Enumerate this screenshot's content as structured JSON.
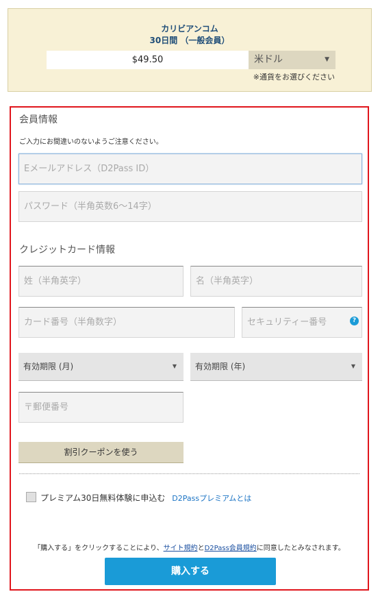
{
  "summary": {
    "site_name": "カリビアンコム",
    "plan": "30日間 （一般会員）",
    "price": "$49.50",
    "currency_selected": "米ドル",
    "currency_note": "※通貨をお選びください"
  },
  "member": {
    "title": "会員情報",
    "note": "ご入力にお間違いのないようご注意ください。",
    "email_placeholder": "Eメールアドレス（D2Pass ID）",
    "password_placeholder": "パスワード（半角英数6〜14字）"
  },
  "card": {
    "title": "クレジットカード情報",
    "last_name_placeholder": "姓（半角英字）",
    "first_name_placeholder": "名（半角英字）",
    "card_number_placeholder": "カード番号（半角数字）",
    "security_placeholder": "セキュリティー番号",
    "help_glyph": "?",
    "exp_month": "有効期限 (月)",
    "exp_year": "有効期限 (年)",
    "postal_placeholder": "〒郵便番号",
    "coupon_label": "割引クーポンを使う"
  },
  "premium": {
    "label": "プレミアム30日無料体験に申込む",
    "link": "D2Passプレミアムとは"
  },
  "terms": {
    "prefix": "「購入する」をクリックすることにより、",
    "link1": "サイト規約",
    "mid": "と",
    "link2": "D2Pass会員規約",
    "suffix": "に同意したとみなされます。"
  },
  "buy_label": "購入する",
  "icons": {
    "dropdown": "chevron-down-icon",
    "help": "question-icon"
  },
  "colors": {
    "accent": "#1a9bd7",
    "frame": "#e0141b",
    "summary_bg": "#f8f1d6"
  }
}
